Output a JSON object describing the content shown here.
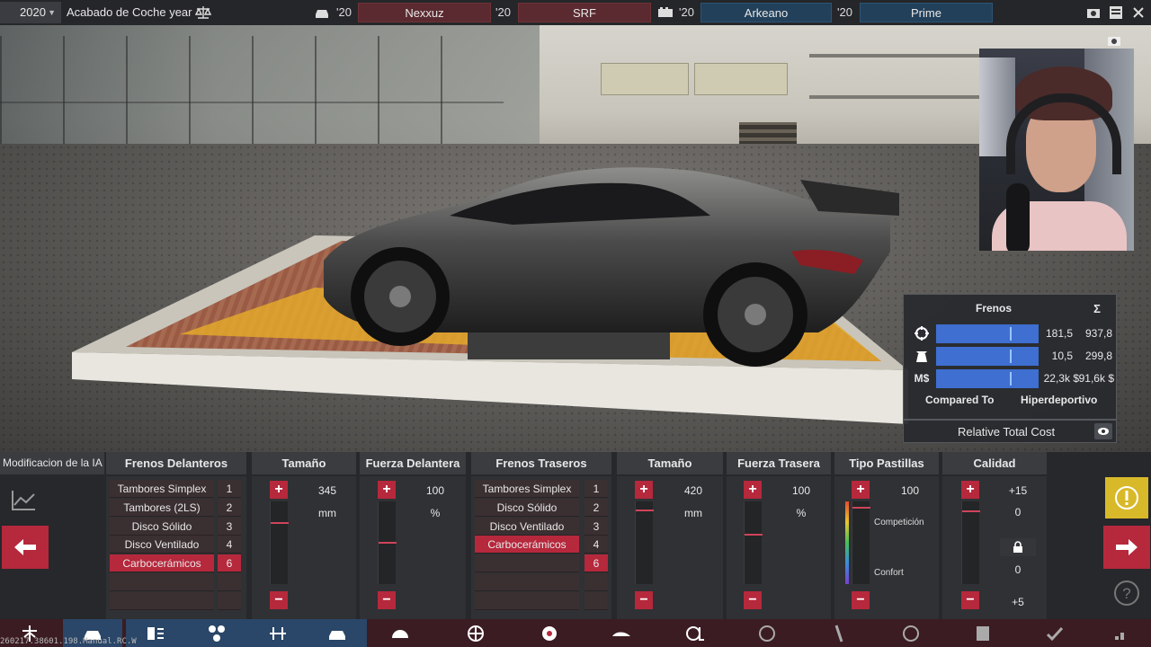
{
  "topbar": {
    "year": "2020",
    "title": "Acabado de Coche year",
    "tabs": [
      {
        "year": "'20",
        "label": "Nexxuz"
      },
      {
        "year": "'20",
        "label": "SRF"
      },
      {
        "year": "'20",
        "label": "Arkeano"
      },
      {
        "year": "'20",
        "label": "Prime"
      }
    ]
  },
  "stats": {
    "header": "Frenos",
    "sigma": "Σ",
    "rows": [
      {
        "icon": "brake-icon",
        "value": "181,5",
        "total": "937,8",
        "fill": 0.73
      },
      {
        "icon": "weight-icon",
        "value": "10,5",
        "total": "299,8",
        "fill": 0.73
      },
      {
        "icon": "money-icon",
        "label": "M$",
        "value": "22,3k $",
        "total": "91,6k $",
        "fill": 0.73
      }
    ],
    "compared_to_label": "Compared To",
    "compared_to_value": "Hiperdeportivo",
    "relative_cost_label": "Relative Total Cost"
  },
  "panel": {
    "ai_label": "Modificacion de la IA",
    "front": {
      "title": "Frenos Delanteros",
      "options": [
        {
          "label": "Tambores Simplex",
          "num": "1"
        },
        {
          "label": "Tambores (2LS)",
          "num": "2"
        },
        {
          "label": "Disco Sólido",
          "num": "3"
        },
        {
          "label": "Disco Ventilado",
          "num": "4"
        },
        {
          "label": "Carbocerámicos",
          "num": "6",
          "selected": true
        }
      ]
    },
    "front_size": {
      "title": "Tamaño",
      "value": "345",
      "unit": "mm",
      "level": 0.25
    },
    "front_force": {
      "title": "Fuerza Delantera",
      "value": "100",
      "unit": "%",
      "level": 0.5
    },
    "rear": {
      "title": "Frenos Traseros",
      "options": [
        {
          "label": "Tambores Simplex",
          "num": "1"
        },
        {
          "label": "Disco Sólido",
          "num": "2"
        },
        {
          "label": "Disco Ventilado",
          "num": "3"
        },
        {
          "label": "Carbocerámicos",
          "num": "4",
          "selected": true
        },
        {
          "label": "",
          "num": "6",
          "selected_num": true
        }
      ]
    },
    "rear_size": {
      "title": "Tamaño",
      "value": "420",
      "unit": "mm",
      "level": 0.1
    },
    "rear_force": {
      "title": "Fuerza Trasera",
      "value": "100",
      "unit": "%",
      "level": 0.4
    },
    "pads": {
      "title": "Tipo Pastillas",
      "value": "100",
      "top_label": "Competición",
      "bottom_label": "Confort"
    },
    "quality": {
      "title": "Calidad",
      "top": "+15",
      "mid1": "0",
      "mid2": "0",
      "bottom": "+5"
    }
  },
  "debug_text": "260217.38601.198.Manual.RC.W",
  "colors": {
    "accent_red": "#b6283c",
    "accent_blue": "#3e6fd1",
    "tab_red": "#5a2a30",
    "tab_blue": "#22405a"
  }
}
